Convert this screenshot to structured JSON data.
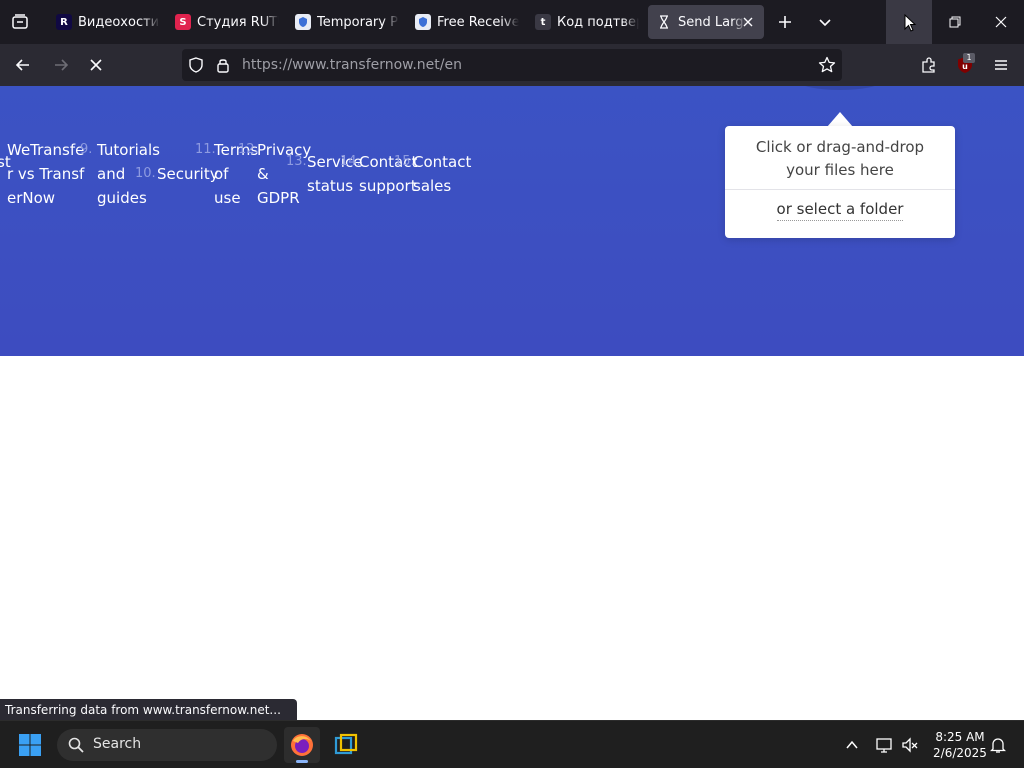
{
  "tabs": [
    {
      "title": "Видеохостинг",
      "icon": "rutube-logo-icon",
      "active": false
    },
    {
      "title": "Студия RUTUBE",
      "icon": "rutube-studio-icon",
      "active": false
    },
    {
      "title": "Temporary Phone",
      "icon": "shield-page-icon",
      "active": false
    },
    {
      "title": "Free Receive SMS",
      "icon": "shield-page-icon",
      "active": false
    },
    {
      "title": "Код подтверждения",
      "icon": "t-logo-icon",
      "active": false
    },
    {
      "title": "Send Large Files",
      "icon": "hourglass-loading-icon",
      "active": true
    }
  ],
  "navbar": {
    "url": "https://www.transfernow.net/en",
    "extension_badge": "1"
  },
  "page": {
    "menu": [
      {
        "num": "",
        "label": "st"
      },
      {
        "num": "",
        "label": "WeTransfer vs TransferNow"
      },
      {
        "num": "9.",
        "label": "Tutorials and guides"
      },
      {
        "num": "10.",
        "label": "Security"
      },
      {
        "num": "11.",
        "label": "Terms of use"
      },
      {
        "num": "12.",
        "label": "Privacy & GDPR"
      },
      {
        "num": "13.",
        "label": "Service status"
      },
      {
        "num": "14.",
        "label": "Contact support"
      },
      {
        "num": "15.",
        "label": "Contact sales"
      }
    ],
    "upload": {
      "drop_text": "Click or drag-and-drop your files here",
      "folder_text": "or select a folder"
    }
  },
  "status_bar": "Transferring data from www.transfernow.net...",
  "taskbar": {
    "search_label": "Search",
    "time": "8:25 AM",
    "date": "2/6/2025"
  },
  "colors": {
    "hero_blue": "#3d4fc1",
    "tab_bg": "#1c1b22",
    "nav_bg": "#2b2a33"
  }
}
